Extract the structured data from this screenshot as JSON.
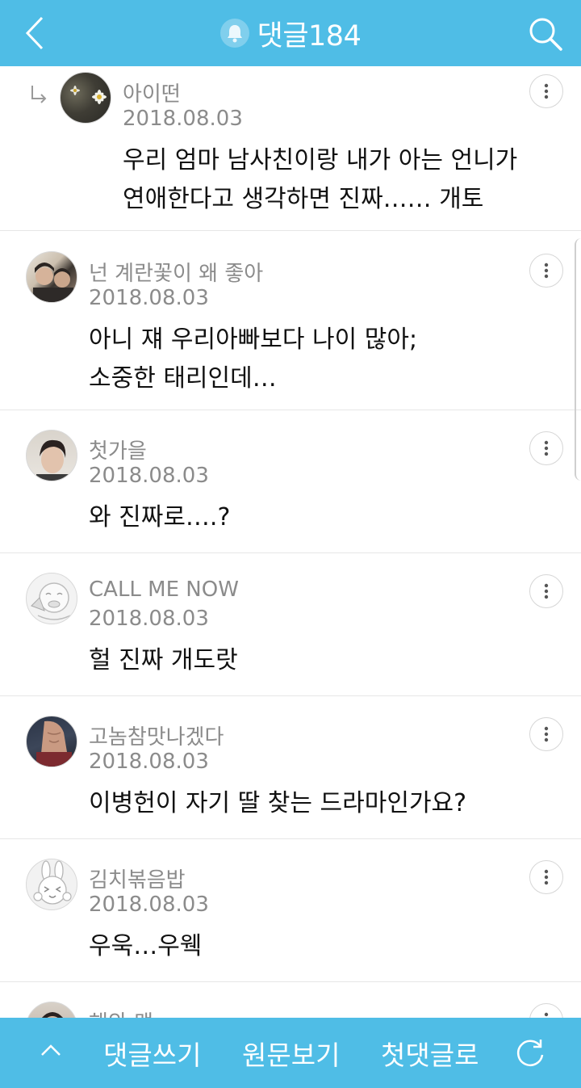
{
  "header": {
    "title": "댓글184",
    "icons": {
      "back": "back-chevron-icon",
      "bell": "bell-icon",
      "search": "search-icon"
    }
  },
  "comments": [
    {
      "author": "아이떤",
      "date": "2018.08.03",
      "lines": [
        "우리 엄마 남사친이랑 내가 아는 언니가",
        "연애한다고 생각하면 진짜…… 개토"
      ],
      "is_reply": true,
      "avatar": "daisy-photo-avatar"
    },
    {
      "author": "넌 계란꽃이 왜 좋아",
      "date": "2018.08.03",
      "lines": [
        "아니 쟤 우리아빠보다 나이 많아;",
        "소중한 태리인데…"
      ],
      "is_reply": false,
      "avatar": "two-people-photo-avatar"
    },
    {
      "author": "첫가을",
      "date": "2018.08.03",
      "lines": [
        "와 진짜로….?"
      ],
      "is_reply": false,
      "avatar": "person-photo-avatar"
    },
    {
      "author": "CALL ME NOW",
      "date": "2018.08.03",
      "lines": [
        "헐 진짜 개도랏"
      ],
      "is_reply": false,
      "avatar": "character-avatar"
    },
    {
      "author": "고놈참맛나겠다",
      "date": "2018.08.03",
      "lines": [
        "이병헌이 자기 딸 찾는 드라마인가요?"
      ],
      "is_reply": false,
      "avatar": "body-photo-avatar"
    },
    {
      "author": "김치볶음밥",
      "date": "2018.08.03",
      "lines": [
        "우욱…우웩"
      ],
      "is_reply": false,
      "avatar": "bunny-character-avatar"
    },
    {
      "author": "해와 맥",
      "date": "",
      "lines": [],
      "is_reply": false,
      "avatar": "person-photo-avatar"
    }
  ],
  "footer": {
    "write_label": "댓글쓰기",
    "original_label": "원문보기",
    "first_label": "첫댓글로",
    "icons": {
      "up": "chevron-up-icon",
      "refresh": "refresh-icon"
    }
  },
  "colors": {
    "accent": "#4fbde6",
    "meta_text": "#8b8b8b",
    "divider": "#e6e6e6"
  }
}
